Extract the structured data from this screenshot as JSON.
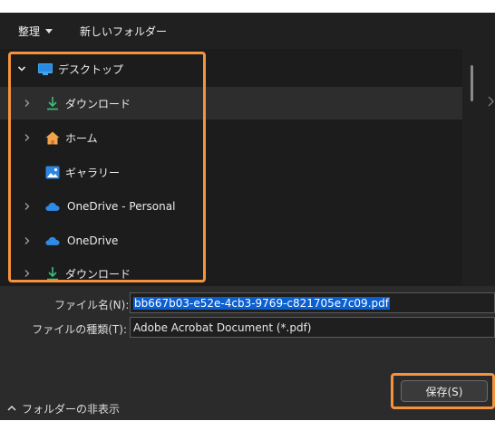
{
  "toolbar": {
    "organize_label": "整理",
    "new_folder_label": "新しいフォルダー"
  },
  "nav": {
    "items": [
      {
        "label": "デスクトップ",
        "icon": "desktop-icon",
        "expanded": true
      },
      {
        "label": "ダウンロード",
        "icon": "download-icon",
        "selected": true
      },
      {
        "label": "ホーム",
        "icon": "home-icon"
      },
      {
        "label": "ギャラリー",
        "icon": "gallery-icon"
      },
      {
        "label": "OneDrive - Personal",
        "icon": "onedrive-icon"
      },
      {
        "label": "OneDrive",
        "icon": "onedrive-icon"
      },
      {
        "label": "ダウンロード",
        "icon": "download-icon"
      }
    ]
  },
  "form": {
    "filename_label": "ファイル名(N):",
    "filename_value": "bb667b03-e52e-4cb3-9769-c821705e7c09.pdf",
    "filetype_label": "ファイルの種類(T):",
    "filetype_value": "Adobe Acrobat Document (*.pdf)"
  },
  "footer": {
    "hide_folders_label": "フォルダーの非表示",
    "save_label": "保存(S)"
  },
  "colors": {
    "highlight": "#f5923e",
    "selection": "#0a5fd1",
    "dialog_bg": "#2b2b2b",
    "nav_bg": "#1c1c1c"
  }
}
